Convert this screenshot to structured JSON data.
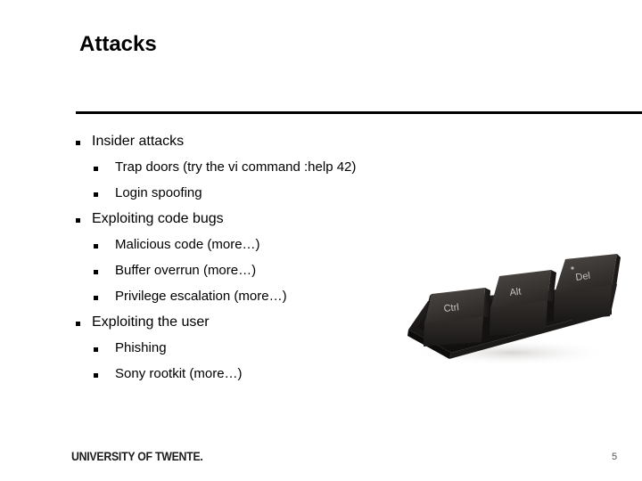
{
  "slide": {
    "title": "Attacks",
    "page_number": "5",
    "footer_logo": "UNIVERSITY OF TWENTE.",
    "background_color": "#ffffff",
    "text_color": "#000000",
    "rule_color": "#000000"
  },
  "bullets": [
    {
      "level": 1,
      "text": "Insider attacks"
    },
    {
      "level": 2,
      "text": "Trap doors (try the vi command :help 42)"
    },
    {
      "level": 2,
      "text": "Login spoofing"
    },
    {
      "level": 1,
      "text": "Exploiting code bugs"
    },
    {
      "level": 2,
      "text": "Malicious code (more…)"
    },
    {
      "level": 2,
      "text": "Buffer overrun (more…)"
    },
    {
      "level": 2,
      "text": "Privilege escalation (more…)"
    },
    {
      "level": 1,
      "text": "Exploiting the user"
    },
    {
      "level": 2,
      "text": "Phishing"
    },
    {
      "level": 2,
      "text": "Sony rootkit (more…)"
    }
  ],
  "figure": {
    "name": "ctrl-alt-del-keys-photo",
    "description": "Three black keyboard keycaps on a black tray",
    "keys": [
      {
        "label": "Ctrl"
      },
      {
        "label": "Alt"
      },
      {
        "label": "Del"
      }
    ],
    "colors": {
      "key_top": "#44403d",
      "key_front": "#2b2725",
      "key_side": "#1e1b1a",
      "tray": "#161413",
      "label_text": "#c9c4c0"
    }
  }
}
